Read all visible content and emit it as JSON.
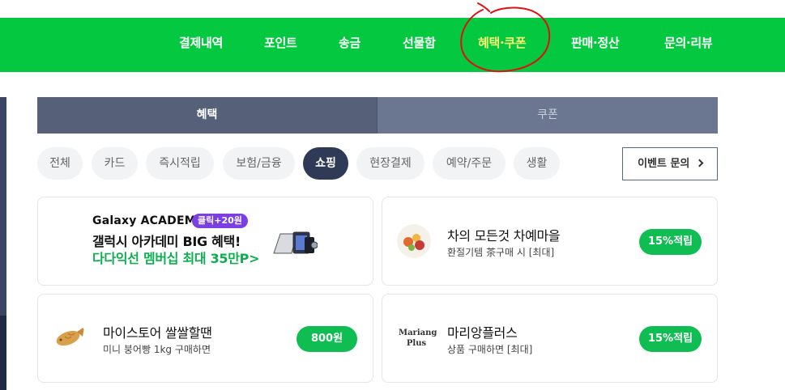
{
  "nav": {
    "items": [
      {
        "label": "결제내역"
      },
      {
        "label": "포인트"
      },
      {
        "label": "송금"
      },
      {
        "label": "선물함"
      },
      {
        "label": "혜택·쿠폰"
      },
      {
        "label": "판매·정산"
      },
      {
        "label": "문의·리뷰"
      }
    ],
    "active_index": 4,
    "bg_color": "#03c840",
    "active_color": "#f9f871"
  },
  "tabs": [
    {
      "label": "혜택",
      "selected": true
    },
    {
      "label": "쿠폰",
      "selected": false
    }
  ],
  "filters": {
    "chips": [
      "전체",
      "카드",
      "즉시적립",
      "보험/금융",
      "쇼핑",
      "현장결제",
      "예약/주문",
      "생활"
    ],
    "selected": "쇼핑",
    "inquiry_label": "이벤트 문의"
  },
  "cards": [
    {
      "type": "ad",
      "brand": "Galaxy ACADEMY",
      "badge": "클릭+20원",
      "line1": "갤럭시 아카데미 BIG 혜택!",
      "line2": "다다익선 멤버십 최대 35만P>"
    },
    {
      "type": "benefit",
      "title": "차의 모든것 차예마을",
      "desc": "환절기템 茶구매 시 [최대]",
      "reward": "15%적립"
    },
    {
      "type": "benefit",
      "title": "마이스토어 쌀쌀할땐",
      "desc": "미니 붕어빵 1kg 구매하면",
      "reward": "800원"
    },
    {
      "type": "benefit",
      "title": "마리앙플러스",
      "desc": "상품 구매하면 [최대]",
      "reward": "15%적립",
      "logo_line1": "Mariang",
      "logo_line2": "Plus"
    }
  ],
  "colors": {
    "tab_selected": "#566179",
    "tab_unselected": "#6b7690",
    "chip_selected": "#2e3a56",
    "reward_pill": "#0fbd52",
    "ad_highlight": "#0dae4f",
    "ad_badge": "#7b3fe4"
  }
}
